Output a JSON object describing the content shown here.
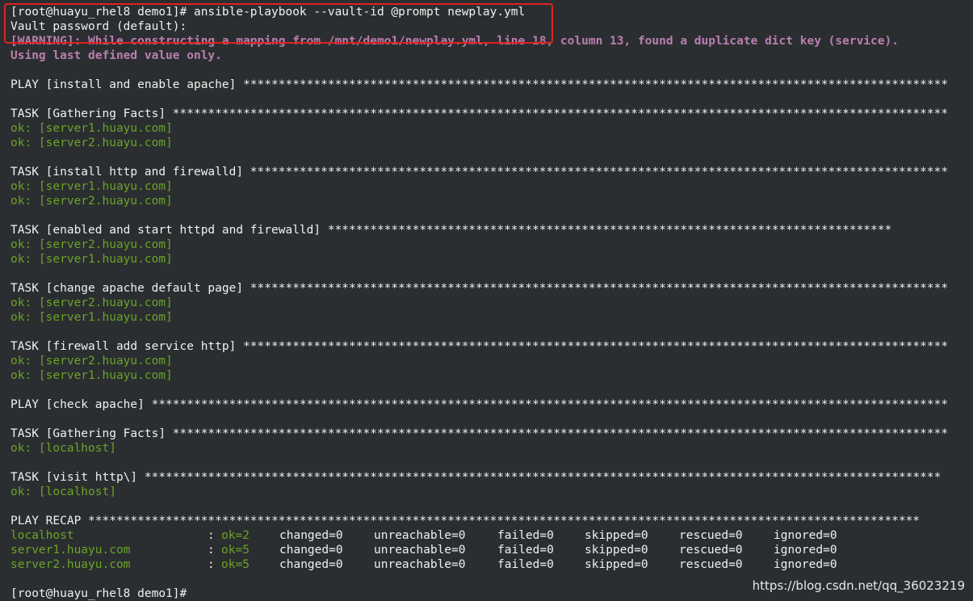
{
  "terminal": {
    "lines": [
      {
        "text": "[root@huayu_rhel8 demo1]# ansible-playbook --vault-id @prompt newplay.yml",
        "style": "white"
      },
      {
        "text": "Vault password (default): ",
        "style": "white"
      },
      {
        "text": "[WARNING]: While constructing a mapping from /mnt/demo1/newplay.yml, line 18, column 13, found a duplicate dict key (service).",
        "style": "purple"
      },
      {
        "text": "Using last defined value only.",
        "style": "purple"
      },
      {
        "text": "",
        "style": "white"
      },
      {
        "text": "PLAY [install and enable apache] ****************************************************************************************************",
        "style": "white"
      },
      {
        "text": "",
        "style": "white"
      },
      {
        "text": "TASK [Gathering Facts] **************************************************************************************************************",
        "style": "white"
      },
      {
        "text": "ok: [server1.huayu.com]",
        "style": "green"
      },
      {
        "text": "ok: [server2.huayu.com]",
        "style": "green"
      },
      {
        "text": "",
        "style": "white"
      },
      {
        "text": "TASK [install http and firewalld] ***************************************************************************************************",
        "style": "white"
      },
      {
        "text": "ok: [server1.huayu.com]",
        "style": "green"
      },
      {
        "text": "ok: [server2.huayu.com]",
        "style": "green"
      },
      {
        "text": "",
        "style": "white"
      },
      {
        "text": "TASK [enabled and start httpd and firewalld] ********************************************************************************",
        "style": "white"
      },
      {
        "text": "ok: [server2.huayu.com]",
        "style": "green"
      },
      {
        "text": "ok: [server1.huayu.com]",
        "style": "green"
      },
      {
        "text": "",
        "style": "white"
      },
      {
        "text": "TASK [change apache default page] ***************************************************************************************************",
        "style": "white"
      },
      {
        "text": "ok: [server2.huayu.com]",
        "style": "green"
      },
      {
        "text": "ok: [server1.huayu.com]",
        "style": "green"
      },
      {
        "text": "",
        "style": "white"
      },
      {
        "text": "TASK [firewall add service http] ****************************************************************************************************",
        "style": "white"
      },
      {
        "text": "ok: [server2.huayu.com]",
        "style": "green"
      },
      {
        "text": "ok: [server1.huayu.com]",
        "style": "green"
      },
      {
        "text": "",
        "style": "white"
      },
      {
        "text": "PLAY [check apache] *****************************************************************************************************************",
        "style": "white"
      },
      {
        "text": "",
        "style": "white"
      },
      {
        "text": "TASK [Gathering Facts] **************************************************************************************************************",
        "style": "white"
      },
      {
        "text": "ok: [localhost]",
        "style": "green"
      },
      {
        "text": "",
        "style": "white"
      },
      {
        "text": "TASK [visit http\\] *****************************************************************************************************************",
        "style": "white"
      },
      {
        "text": "ok: [localhost]",
        "style": "green"
      },
      {
        "text": "",
        "style": "white"
      },
      {
        "text": "PLAY RECAP **********************************************************************************************************************",
        "style": "white"
      }
    ],
    "recap": [
      {
        "host": "localhost",
        "ok": "ok=2",
        "changed": "changed=0",
        "unreachable": "unreachable=0",
        "failed": "failed=0",
        "skipped": "skipped=0",
        "rescued": "rescued=0",
        "ignored": "ignored=0"
      },
      {
        "host": "server1.huayu.com",
        "ok": "ok=5",
        "changed": "changed=0",
        "unreachable": "unreachable=0",
        "failed": "failed=0",
        "skipped": "skipped=0",
        "rescued": "rescued=0",
        "ignored": "ignored=0"
      },
      {
        "host": "server2.huayu.com",
        "ok": "ok=5",
        "changed": "changed=0",
        "unreachable": "unreachable=0",
        "failed": "failed=0",
        "skipped": "skipped=0",
        "rescued": "rescued=0",
        "ignored": "ignored=0"
      }
    ],
    "recap_colon": ":",
    "final_prompt": "[root@huayu_rhel8 demo1]# "
  },
  "watermark": "https://blog.csdn.net/qq_36023219",
  "colors": {
    "background": "#2b2e30",
    "text": "#f0f0f0",
    "ok_green": "#6aa327",
    "warning_purple": "#b97fb0",
    "highlight_red": "#e02020"
  }
}
